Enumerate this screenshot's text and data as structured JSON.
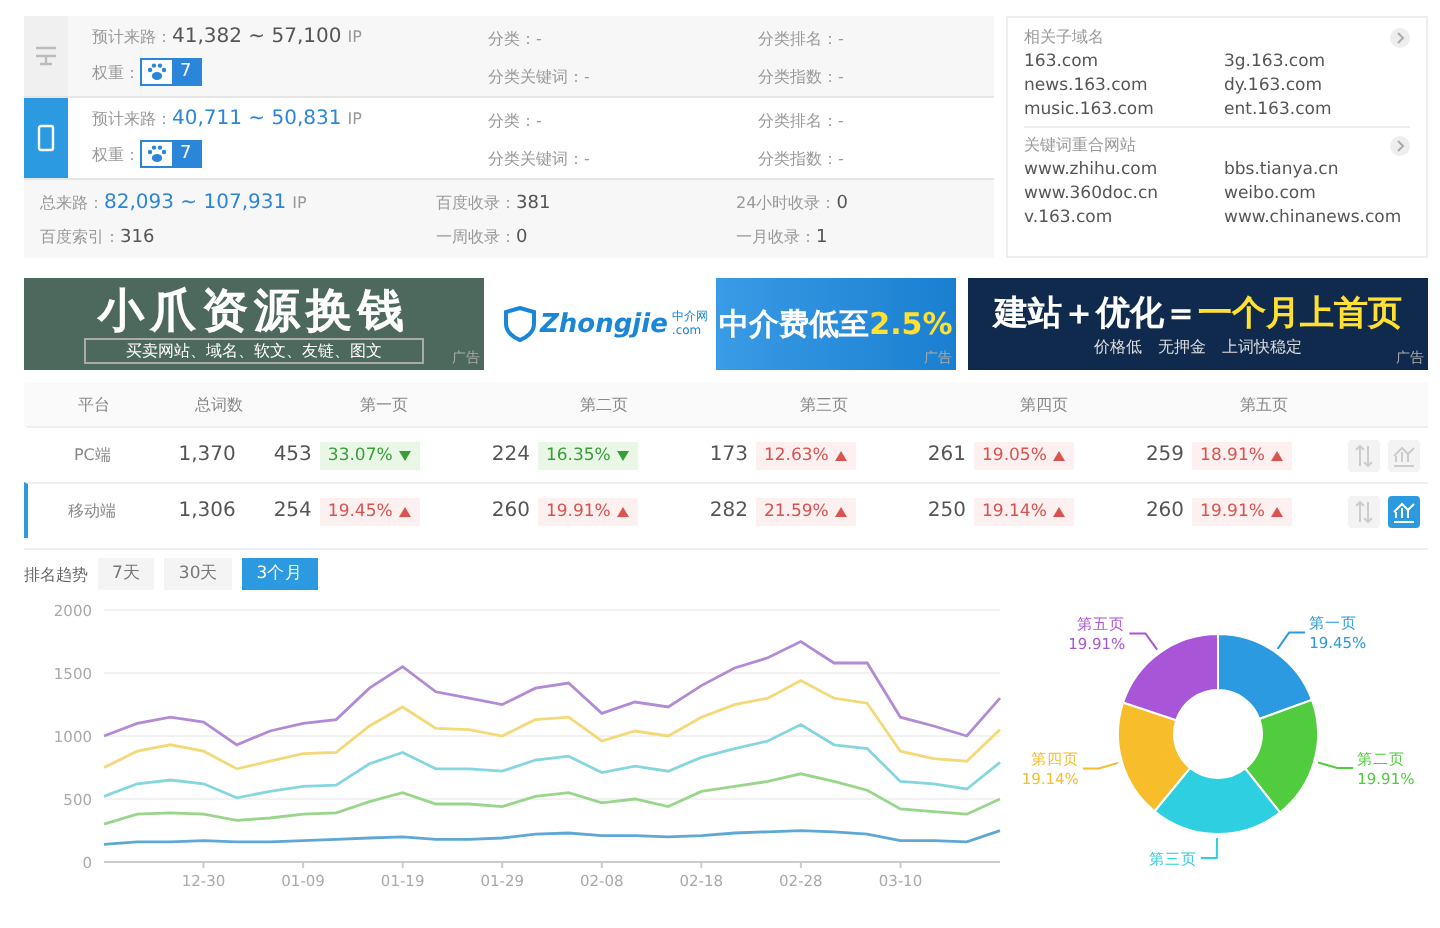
{
  "overview": {
    "rows": [
      {
        "kind": "desktop",
        "selected": false,
        "traffic_label": "预计来路：",
        "traffic": "41,382 ~ 57,100",
        "unit": "IP",
        "weight_label": "权重：",
        "weight": "7",
        "fields": [
          "分类：-",
          "分类关键词：-",
          "分类排名：-",
          "分类指数：-"
        ]
      },
      {
        "kind": "mobile",
        "selected": true,
        "traffic_label": "预计来路：",
        "traffic": "40,711 ~ 50,831",
        "unit": "IP",
        "weight_label": "权重：",
        "weight": "7",
        "fields": [
          "分类：-",
          "分类关键词：-",
          "分类排名：-",
          "分类指数：-"
        ]
      }
    ],
    "summary": {
      "total_label": "总来路：",
      "total": "82,093 ~ 107,931",
      "unit": "IP",
      "stats": [
        {
          "label": "百度收录：",
          "value": "381"
        },
        {
          "label": "24小时收录：",
          "value": "0"
        },
        {
          "label": "百度索引：",
          "value": "316"
        },
        {
          "label": "一周收录：",
          "value": "0"
        },
        {
          "label": "一月收录：",
          "value": "1"
        }
      ]
    }
  },
  "related": [
    {
      "title": "相关子域名",
      "domains": [
        "163.com",
        "3g.163.com",
        "news.163.com",
        "dy.163.com",
        "music.163.com",
        "ent.163.com"
      ]
    },
    {
      "title": "关键词重合网站",
      "domains": [
        "www.zhihu.com",
        "bbs.tianya.cn",
        "www.360doc.cn",
        "weibo.com",
        "v.163.com",
        "www.chinanews.com"
      ]
    }
  ],
  "banners": [
    {
      "kind": "resource",
      "headline": "小爪资源换钱",
      "subline": "买卖网站、域名、软文、友链、图文",
      "tag": "广告"
    },
    {
      "kind": "agency",
      "logo": "Zhongjie",
      "logo_cn": "中介网",
      "logo_tld": ".com",
      "headline": "中介费低至",
      "highlight": "2.5%",
      "tag": "广告"
    },
    {
      "kind": "seo",
      "headline": "建站＋优化＝",
      "highlight": "一个月上首页",
      "subline": "价格低　无押金　上词快稳定",
      "tag": "广告"
    }
  ],
  "rank_table": {
    "columns": [
      "平台",
      "总词数",
      "第一页",
      "第二页",
      "第三页",
      "第四页",
      "第五页"
    ],
    "rows": [
      {
        "platform": "PC端",
        "total": "1,370",
        "selected": false,
        "pages": [
          {
            "count": "453",
            "pct": "33.07%",
            "kind": "down"
          },
          {
            "count": "224",
            "pct": "16.35%",
            "kind": "down"
          },
          {
            "count": "173",
            "pct": "12.63%",
            "kind": "up"
          },
          {
            "count": "261",
            "pct": "19.05%",
            "kind": "up"
          },
          {
            "count": "259",
            "pct": "18.91%",
            "kind": "up"
          }
        ]
      },
      {
        "platform": "移动端",
        "total": "1,306",
        "selected": true,
        "pages": [
          {
            "count": "254",
            "pct": "19.45%",
            "kind": "up"
          },
          {
            "count": "260",
            "pct": "19.91%",
            "kind": "up"
          },
          {
            "count": "282",
            "pct": "21.59%",
            "kind": "up"
          },
          {
            "count": "250",
            "pct": "19.14%",
            "kind": "up"
          },
          {
            "count": "260",
            "pct": "19.91%",
            "kind": "up"
          }
        ]
      }
    ]
  },
  "trend": {
    "label": "排名趋势",
    "tabs": [
      {
        "label": "7天",
        "selected": false
      },
      {
        "label": "30天",
        "selected": false
      },
      {
        "label": "3个月",
        "selected": true
      }
    ],
    "chart_data": {
      "type": "line",
      "categories": [
        null,
        null,
        null,
        "12-30",
        null,
        null,
        "01-09",
        null,
        null,
        "01-19",
        null,
        null,
        "01-29",
        null,
        null,
        "02-08",
        null,
        null,
        "02-18",
        null,
        null,
        "02-28",
        null,
        null,
        "03-10",
        null,
        null,
        null
      ],
      "ylim": [
        0,
        2000
      ],
      "yticks": [
        0,
        500,
        1000,
        1500,
        2000
      ],
      "grid": true,
      "series": [
        {
          "color": "#b28ad6",
          "values": [
            1000,
            1100,
            1150,
            1110,
            930,
            1040,
            1100,
            1130,
            1380,
            1550,
            1350,
            1300,
            1250,
            1380,
            1420,
            1180,
            1270,
            1230,
            1400,
            1540,
            1620,
            1750,
            1580,
            1580,
            1150,
            1080,
            1000,
            1300
          ]
        },
        {
          "color": "#f4d978",
          "values": [
            750,
            880,
            930,
            880,
            740,
            800,
            860,
            870,
            1080,
            1230,
            1060,
            1050,
            1000,
            1130,
            1150,
            960,
            1040,
            1000,
            1150,
            1250,
            1300,
            1440,
            1300,
            1260,
            880,
            820,
            800,
            1050
          ]
        },
        {
          "color": "#86d6df",
          "values": [
            520,
            620,
            650,
            620,
            510,
            560,
            600,
            610,
            780,
            870,
            740,
            740,
            720,
            810,
            840,
            710,
            760,
            720,
            830,
            900,
            960,
            1090,
            930,
            900,
            640,
            620,
            580,
            790
          ]
        },
        {
          "color": "#9ad58c",
          "values": [
            300,
            380,
            390,
            380,
            330,
            350,
            380,
            390,
            480,
            550,
            460,
            460,
            440,
            520,
            550,
            470,
            500,
            440,
            560,
            600,
            640,
            700,
            640,
            570,
            420,
            400,
            380,
            500
          ]
        },
        {
          "color": "#5fa8d6",
          "values": [
            140,
            160,
            160,
            170,
            160,
            160,
            170,
            180,
            190,
            200,
            180,
            180,
            190,
            220,
            230,
            210,
            210,
            200,
            210,
            230,
            240,
            250,
            240,
            220,
            170,
            170,
            160,
            250
          ]
        }
      ]
    }
  },
  "distribution": {
    "chart_data": {
      "type": "donut",
      "categories": [
        "第一页",
        "第二页",
        "第三页",
        "第四页",
        "第五页"
      ],
      "values": [
        19.45,
        19.91,
        21.59,
        19.14,
        19.91
      ],
      "colors": [
        "#2b9ae0",
        "#52cc3f",
        "#2dcfe0",
        "#f7bd2a",
        "#a855d8"
      ],
      "value_labels": [
        "19.45%",
        "19.91%",
        null,
        "19.14%",
        "19.91%"
      ]
    }
  }
}
